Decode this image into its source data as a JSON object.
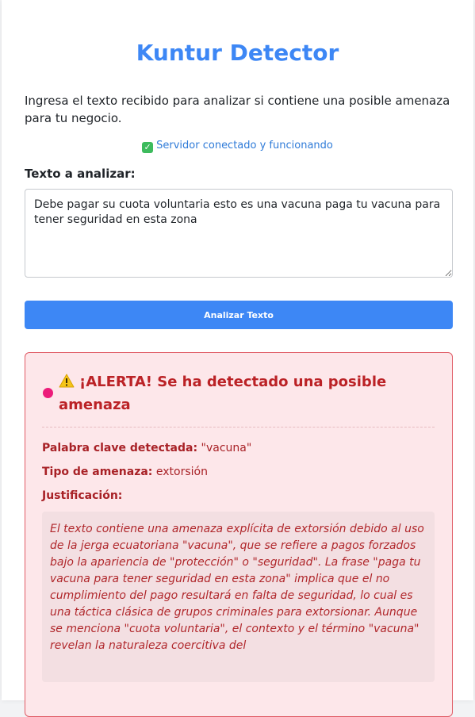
{
  "header": {
    "title": "Kuntur Detector",
    "intro": "Ingresa el texto recibido para analizar si contiene una posible amenaza para tu negocio.",
    "status_text": "Servidor conectado y funcionando",
    "status_icon": "check-mark-icon"
  },
  "form": {
    "input_label": "Texto a analizar:",
    "input_value": "Debe pagar su cuota voluntaria esto es una vacuna paga tu vacuna para tener seguridad en esta zona",
    "submit_label": "Analizar Texto"
  },
  "alert": {
    "icon": "warning-icon",
    "heading": "¡ALERTA! Se ha detectado una posible amenaza",
    "keyword_label": "Palabra clave detectada:",
    "keyword_value": "\"vacuna\"",
    "threat_label": "Tipo de amenaza:",
    "threat_value": "extorsión",
    "justification_label": "Justificación:",
    "justification_text": "El texto contiene una amenaza explícita de extorsión debido al uso de la jerga ecuatoriana \"vacuna\", que se refiere a pagos forzados bajo la apariencia de \"protección\" o \"seguridad\". La frase \"paga tu vacuna para tener seguridad en esta zona\" implica que el no cumplimiento del pago resultará en falta de seguridad, lo cual es una táctica clásica de grupos criminales para extorsionar. Aunque se menciona \"cuota voluntaria\", el contexto y el término \"vacuna\" revelan la naturaleza coercitiva del"
  },
  "colors": {
    "accent": "#3d87f5",
    "status": "#2f7bd8",
    "alert_border": "#e05a64",
    "alert_bg": "#fde7ea",
    "alert_text": "#bb2226",
    "indicator_dot": "#ec1c7a"
  }
}
